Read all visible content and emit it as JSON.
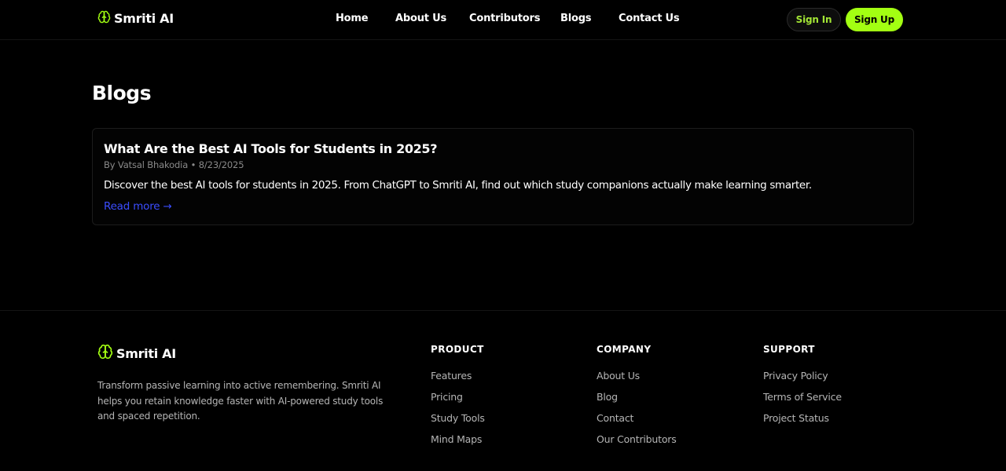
{
  "header": {
    "brand": "Smriti AI",
    "nav": [
      "Home",
      "About Us",
      "Contributors",
      "Blogs",
      "Contact Us"
    ],
    "sign_in": "Sign In",
    "sign_up": "Sign Up"
  },
  "main": {
    "title": "Blogs",
    "posts": [
      {
        "title": "What Are the Best AI Tools for Students in 2025?",
        "meta": "By Vatsal Bhakodia • 8/23/2025",
        "excerpt": "Discover the best AI tools for students in 2025. From ChatGPT to Smriti AI, find out which study companions actually make learning smarter.",
        "read_more": "Read more →"
      }
    ]
  },
  "footer": {
    "brand": "Smriti AI",
    "description": "Transform passive learning into active remembering. Smriti AI helps you retain knowledge faster with AI-powered study tools and spaced repetition.",
    "columns": [
      {
        "heading": "PRODUCT",
        "links": [
          "Features",
          "Pricing",
          "Study Tools",
          "Mind Maps"
        ]
      },
      {
        "heading": "COMPANY",
        "links": [
          "About Us",
          "Blog",
          "Contact",
          "Our Contributors"
        ]
      },
      {
        "heading": "SUPPORT",
        "links": [
          "Privacy Policy",
          "Terms of Service",
          "Project Status"
        ]
      }
    ]
  },
  "colors": {
    "accent": "#a3ff12",
    "link": "#3b4dff",
    "background": "#000000"
  },
  "icons": {
    "brand": "brain-icon"
  }
}
